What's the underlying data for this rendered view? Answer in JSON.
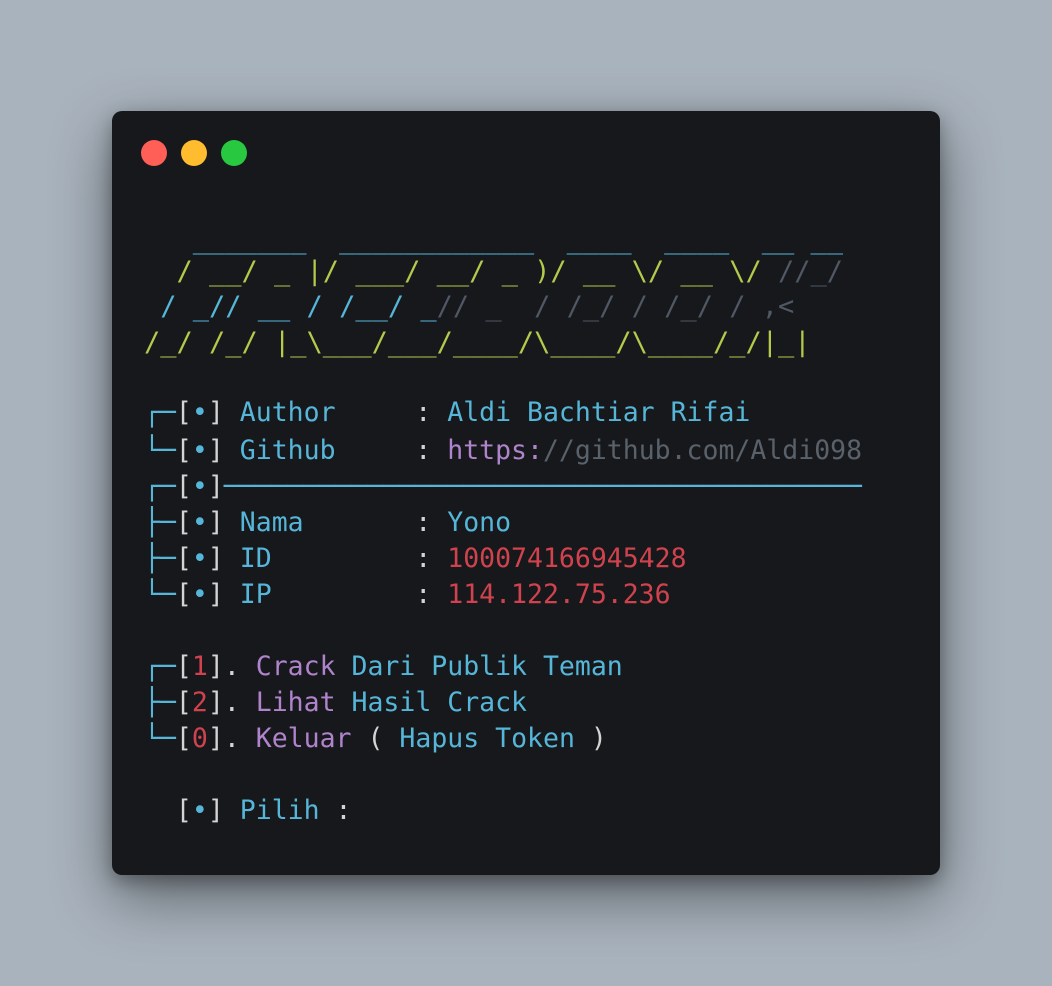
{
  "banner": {
    "line1": "   _______  ____________  ____  ____  __ __",
    "line2a": "  / __/ _ |/ ___/ __/ _ )/ __ \\/ __ \\/",
    "line2b": " //_/",
    "line3a": " / _// __ / /__/ _",
    "line3b": "// _  / /_/ / /_/ / ,<",
    "line4": "/_/ /_/ |_\\___/___/____/\\____/\\____/_/|_|"
  },
  "info": {
    "author_label": "Author     ",
    "author_value": "Aldi Bachtiar Rifai",
    "github_label": "Github     ",
    "github_scheme": "https:",
    "github_rest": "//github.com/Aldi098",
    "nama_label": "Nama       ",
    "nama_value": "Yono",
    "id_label": "ID         ",
    "id_value": "100074166945428",
    "ip_label": "IP         ",
    "ip_value": "114.122.75.236"
  },
  "menu": [
    {
      "num": "1",
      "word1": "Crack",
      "rest": "Dari Publik Teman"
    },
    {
      "num": "2",
      "word1": "Lihat",
      "rest": "Hasil Crack"
    },
    {
      "num": "0",
      "word1": "Keluar",
      "paren_open": "(",
      "rest": "Hapus Token",
      "paren_close": ")"
    }
  ],
  "prompt": {
    "label": "Pilih"
  },
  "glyphs": {
    "box_top": "┌─",
    "box_mid": "├─",
    "box_bot": "└─",
    "bracket_open": "[",
    "bracket_close": "]",
    "bullet": "•",
    "colon": ":",
    "menu_dot": ".",
    "separator": "────────────────────────────────────────"
  },
  "colors": {
    "background": "#a9b3bd",
    "terminal": "#17181b",
    "blue": "#56b6d9",
    "yellow": "#b5c94c",
    "purple": "#b084cc",
    "red": "#d0434e"
  }
}
